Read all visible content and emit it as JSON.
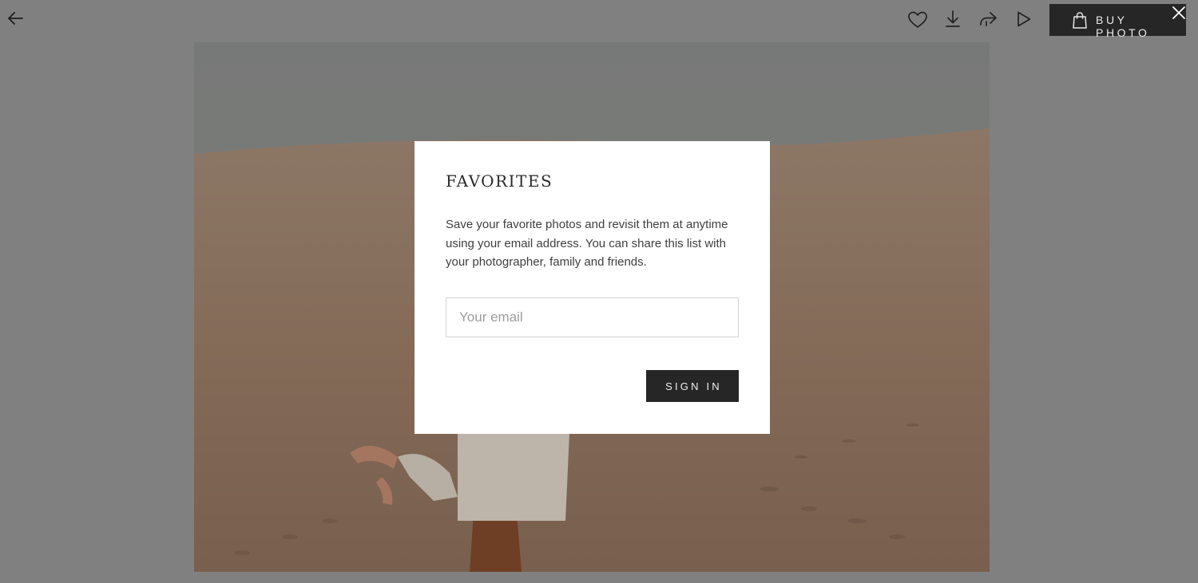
{
  "toolbar": {
    "back_icon": "arrow-left-icon",
    "favorite_icon": "heart-icon",
    "download_icon": "download-icon",
    "share_icon": "share-icon",
    "slideshow_icon": "play-icon",
    "buy_label": "BUY PHOTO",
    "buy_icon": "shopping-bag-icon",
    "close_icon": "close-icon"
  },
  "photo": {
    "subject": "photo-viewer-image"
  },
  "modal": {
    "title": "FAVORITES",
    "description": "Save your favorite photos and revisit them at anytime using your email address. You can share this list with your photographer, family and friends.",
    "email_placeholder": "Your email",
    "email_value": "",
    "signin_label": "SIGN IN"
  },
  "colors": {
    "overlay": "#808080",
    "button_dark": "#262626",
    "modal_bg": "#ffffff"
  }
}
